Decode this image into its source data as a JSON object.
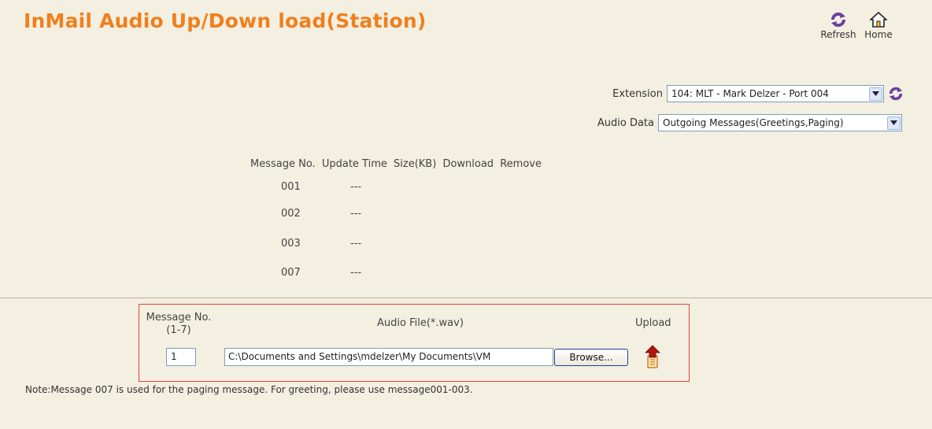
{
  "page": {
    "title": "InMail Audio Up/Down load(Station)"
  },
  "toolbar": {
    "refresh_label": "Refresh",
    "home_label": "Home"
  },
  "filters": {
    "extension_label": "Extension",
    "extension_value": "104: MLT - Mark Delzer - Port 004",
    "audio_data_label": "Audio Data",
    "audio_data_value": "Outgoing Messages(Greetings,Paging)"
  },
  "messages": {
    "columns": [
      "Message No.",
      "Update Time",
      "Size(KB)",
      "Download",
      "Remove"
    ],
    "rows": [
      {
        "number": "001",
        "update_time": "---"
      },
      {
        "number": "002",
        "update_time": "---"
      },
      {
        "number": "003",
        "update_time": "---"
      },
      {
        "number": "007",
        "update_time": "---"
      }
    ]
  },
  "upload": {
    "msgno_header_line1": "Message No.",
    "msgno_header_line2": "(1-7)",
    "audio_file_header": "Audio File(*.wav)",
    "upload_header": "Upload",
    "msgno_value": "1",
    "file_path": "C:\\Documents and Settings\\mdelzer\\My Documents\\VM",
    "browse_label": "Browse..."
  },
  "note": "Note:Message 007 is used for the paging message. For greeting, please use message001-003.",
  "colors": {
    "title": "#f07f1c",
    "background": "#f3efe1",
    "upload_border": "#e8413c"
  },
  "icons": {
    "refresh": "refresh-icon",
    "home": "home-icon",
    "upload": "upload-icon"
  }
}
